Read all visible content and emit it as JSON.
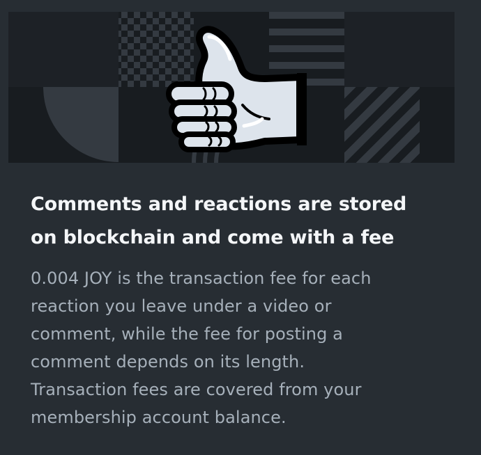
{
  "dialog": {
    "illustration": {
      "icon": "thumbs-up-icon",
      "background_colors": {
        "panel": "#181c20",
        "pattern": "#343a41",
        "hand_fill": "#dde4ec",
        "hand_outline": "#000000"
      }
    },
    "title_lines": [
      "Comments and reactions are stored",
      "on blockchain and come with a fee"
    ],
    "body_lines": [
      "0.004 JOY is the transaction fee for each",
      "reaction you leave under a video or",
      "comment, while the fee for posting a",
      "comment depends on its length.",
      "Transaction fees are covered from your",
      "membership account balance."
    ],
    "colors": {
      "background": "#272d33",
      "title": "#f4f6f8",
      "body": "#a6b0ba"
    }
  }
}
